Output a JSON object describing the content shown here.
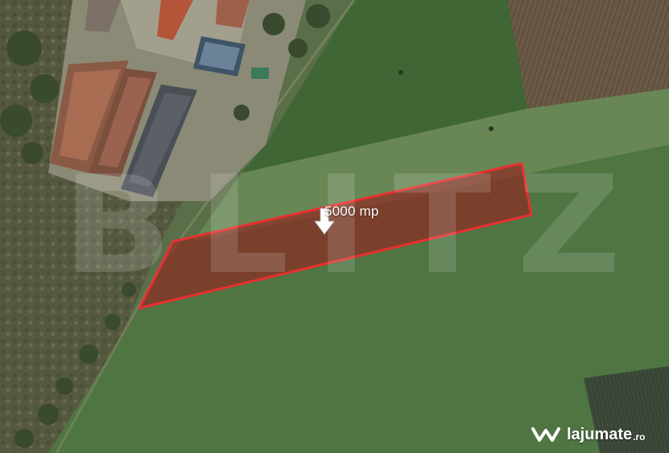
{
  "map": {
    "area_label": "5000 mp",
    "watermark": "BLITZ",
    "brand": {
      "name": "lajumate",
      "tld": ".ro"
    },
    "plot_outline_color": "#e8302f",
    "plot_fill_color": "#8e2a22",
    "icons": {
      "marker": "down-arrow-icon",
      "brand_logo": "lajumate-logo-icon"
    }
  }
}
